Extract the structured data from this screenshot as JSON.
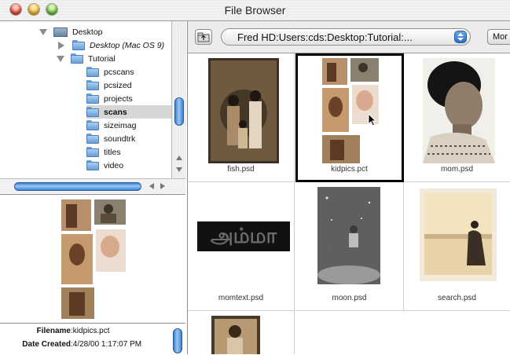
{
  "window": {
    "title": "File Browser"
  },
  "tree": {
    "items": [
      {
        "label": "Desktop",
        "style": "normal"
      },
      {
        "label": "Desktop (Mac OS 9)",
        "style": "italic"
      },
      {
        "label": "Tutorial",
        "style": "normal"
      },
      {
        "label": "pcscans",
        "style": "normal"
      },
      {
        "label": "pcsized",
        "style": "normal"
      },
      {
        "label": "projects",
        "style": "normal"
      },
      {
        "label": "scans",
        "style": "bold"
      },
      {
        "label": "sizeimag",
        "style": "normal"
      },
      {
        "label": "soundtrk",
        "style": "normal"
      },
      {
        "label": "titles",
        "style": "normal"
      },
      {
        "label": "video",
        "style": "normal"
      }
    ],
    "selected": "scans"
  },
  "info": {
    "filename_key": "Filename",
    "filename_value": "kidpics.pct",
    "date_key": "Date Created",
    "date_value": "4/28/00 1:17:07 PM"
  },
  "toolbar": {
    "path": "Fred HD:Users:cds:Desktop:Tutorial:...",
    "more_label": "Mor"
  },
  "files": [
    {
      "name": "fish.psd"
    },
    {
      "name": "kidpics.pct",
      "selected": true
    },
    {
      "name": "mom.psd"
    },
    {
      "name": "momtext.psd",
      "thumb_text": "அம்மா"
    },
    {
      "name": "moon.psd"
    },
    {
      "name": "search.psd"
    },
    {
      "name": ""
    }
  ],
  "colors": {
    "accent": "#3b7fcf",
    "selection": "#000000"
  }
}
